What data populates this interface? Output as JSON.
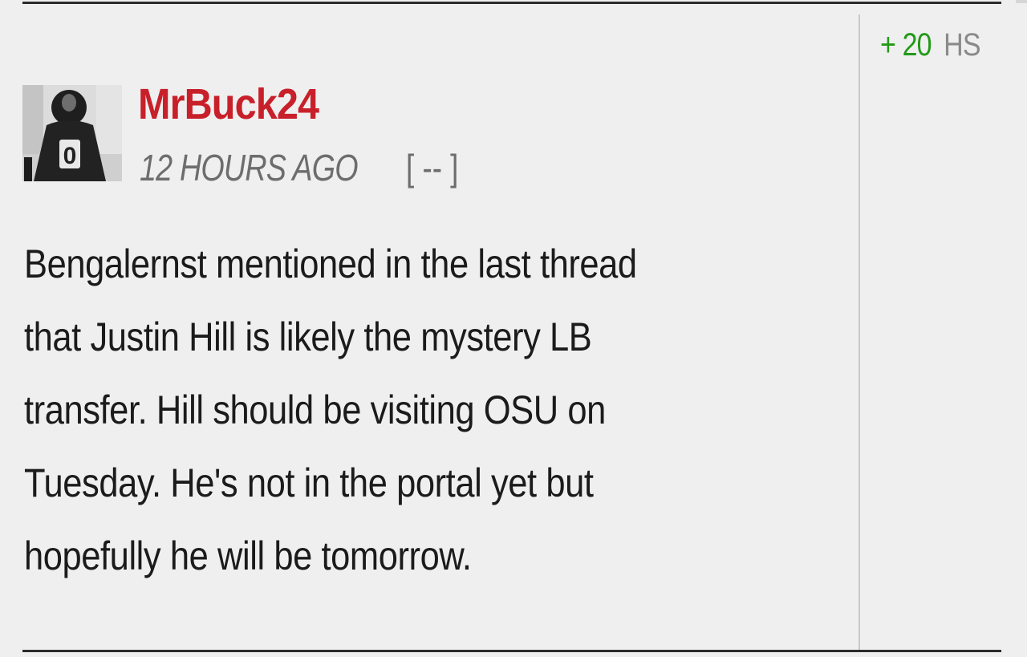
{
  "score": {
    "sign": "+",
    "value": "20",
    "unit": "HS",
    "value_color": "#229a18"
  },
  "comment": {
    "username": "MrBuck24",
    "username_color": "#c8202a",
    "timestamp": "12 HOURS AGO",
    "collapse_label": "[ -- ]",
    "avatar_icon": "player-avatar-jersey-0-icon",
    "avatar_jersey_number": "0",
    "body_lines": [
      "Bengalernst mentioned in the last thread",
      "that Justin Hill is likely the mystery LB",
      "transfer. Hill should be visiting OSU on",
      "Tuesday. He's not in the portal yet but",
      "hopefully he will be tomorrow."
    ]
  }
}
